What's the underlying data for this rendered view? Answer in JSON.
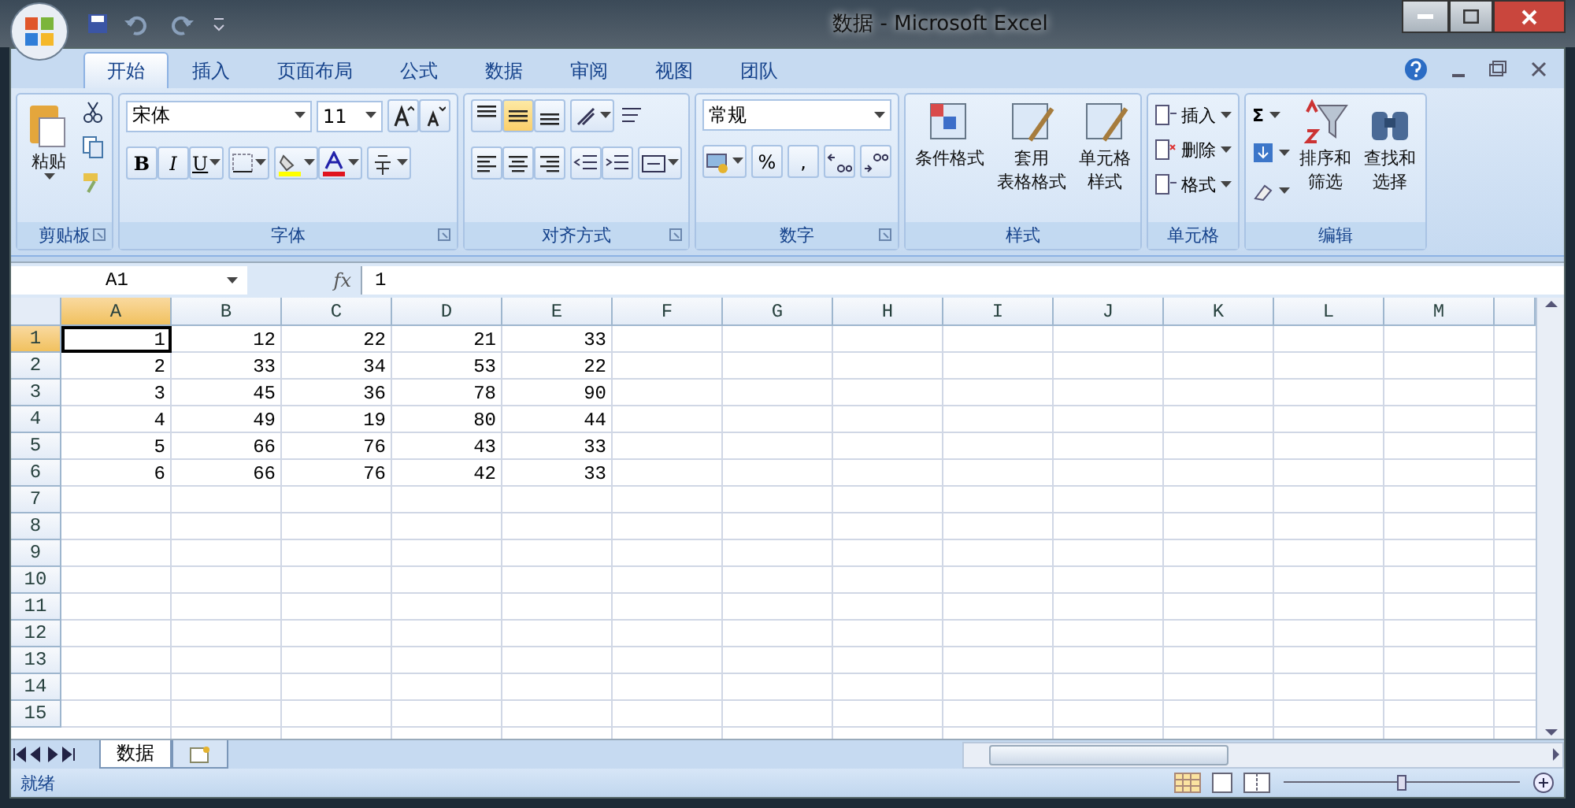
{
  "window": {
    "title": "数据 - Microsoft Excel"
  },
  "ribbon_tabs": [
    {
      "label": "开始",
      "selected": true
    },
    {
      "label": "插入",
      "selected": false
    },
    {
      "label": "页面布局",
      "selected": false
    },
    {
      "label": "公式",
      "selected": false
    },
    {
      "label": "数据",
      "selected": false
    },
    {
      "label": "审阅",
      "selected": false
    },
    {
      "label": "视图",
      "selected": false
    },
    {
      "label": "团队",
      "selected": false
    }
  ],
  "clipboard": {
    "paste": "粘贴",
    "label": "剪贴板"
  },
  "font": {
    "name": "宋体",
    "size": "11",
    "bold": "B",
    "italic": "I",
    "underline": "U",
    "label": "字体"
  },
  "alignment": {
    "valign": [
      {
        "selected": false
      },
      {
        "selected": true
      },
      {
        "selected": false
      }
    ],
    "label": "对齐方式"
  },
  "number": {
    "format": "常规",
    "percent": "%",
    "comma": ",",
    "label": "数字"
  },
  "styles": {
    "buttons": [
      {
        "lines": [
          "条件格式"
        ]
      },
      {
        "lines": [
          "套用",
          "表格格式"
        ]
      },
      {
        "lines": [
          "单元格",
          "样式"
        ]
      }
    ],
    "label": "样式"
  },
  "cells": {
    "buttons": [
      "插入",
      "删除",
      "格式"
    ],
    "label": "单元格"
  },
  "editing": {
    "sum": "Σ",
    "buttons": [
      {
        "lines": [
          "排序和",
          "筛选"
        ]
      },
      {
        "lines": [
          "查找和",
          "选择"
        ]
      }
    ],
    "label": "编辑"
  },
  "formula_bar": {
    "name_box": "A1",
    "fx": "fx",
    "value": "1"
  },
  "sheet": {
    "columns": [
      {
        "label": "A",
        "selected": true
      },
      {
        "label": "B",
        "selected": false
      },
      {
        "label": "C",
        "selected": false
      },
      {
        "label": "D",
        "selected": false
      },
      {
        "label": "E",
        "selected": false
      },
      {
        "label": "F",
        "selected": false
      },
      {
        "label": "G",
        "selected": false
      },
      {
        "label": "H",
        "selected": false
      },
      {
        "label": "I",
        "selected": false
      },
      {
        "label": "J",
        "selected": false
      },
      {
        "label": "K",
        "selected": false
      },
      {
        "label": "L",
        "selected": false
      },
      {
        "label": "M",
        "selected": false
      }
    ],
    "rows": [
      {
        "label": "1",
        "selected": true,
        "cells": [
          "1",
          "12",
          "22",
          "21",
          "33"
        ]
      },
      {
        "label": "2",
        "selected": false,
        "cells": [
          "2",
          "33",
          "34",
          "53",
          "22"
        ]
      },
      {
        "label": "3",
        "selected": false,
        "cells": [
          "3",
          "45",
          "36",
          "78",
          "90"
        ]
      },
      {
        "label": "4",
        "selected": false,
        "cells": [
          "4",
          "49",
          "19",
          "80",
          "44"
        ]
      },
      {
        "label": "5",
        "selected": false,
        "cells": [
          "5",
          "66",
          "76",
          "43",
          "33"
        ]
      },
      {
        "label": "6",
        "selected": false,
        "cells": [
          "6",
          "66",
          "76",
          "42",
          "33"
        ]
      },
      {
        "label": "7",
        "selected": false
      },
      {
        "label": "8",
        "selected": false
      },
      {
        "label": "9",
        "selected": false
      },
      {
        "label": "10",
        "selected": false
      },
      {
        "label": "11",
        "selected": false
      },
      {
        "label": "12",
        "selected": false
      },
      {
        "label": "13",
        "selected": false
      },
      {
        "label": "14",
        "selected": false
      },
      {
        "label": "15",
        "selected": false
      }
    ]
  },
  "sheet_tabs": [
    {
      "label": "数据",
      "selected": true
    }
  ],
  "status_bar": {
    "text": "就绪",
    "zoom": {
      "level": 0.5
    }
  }
}
